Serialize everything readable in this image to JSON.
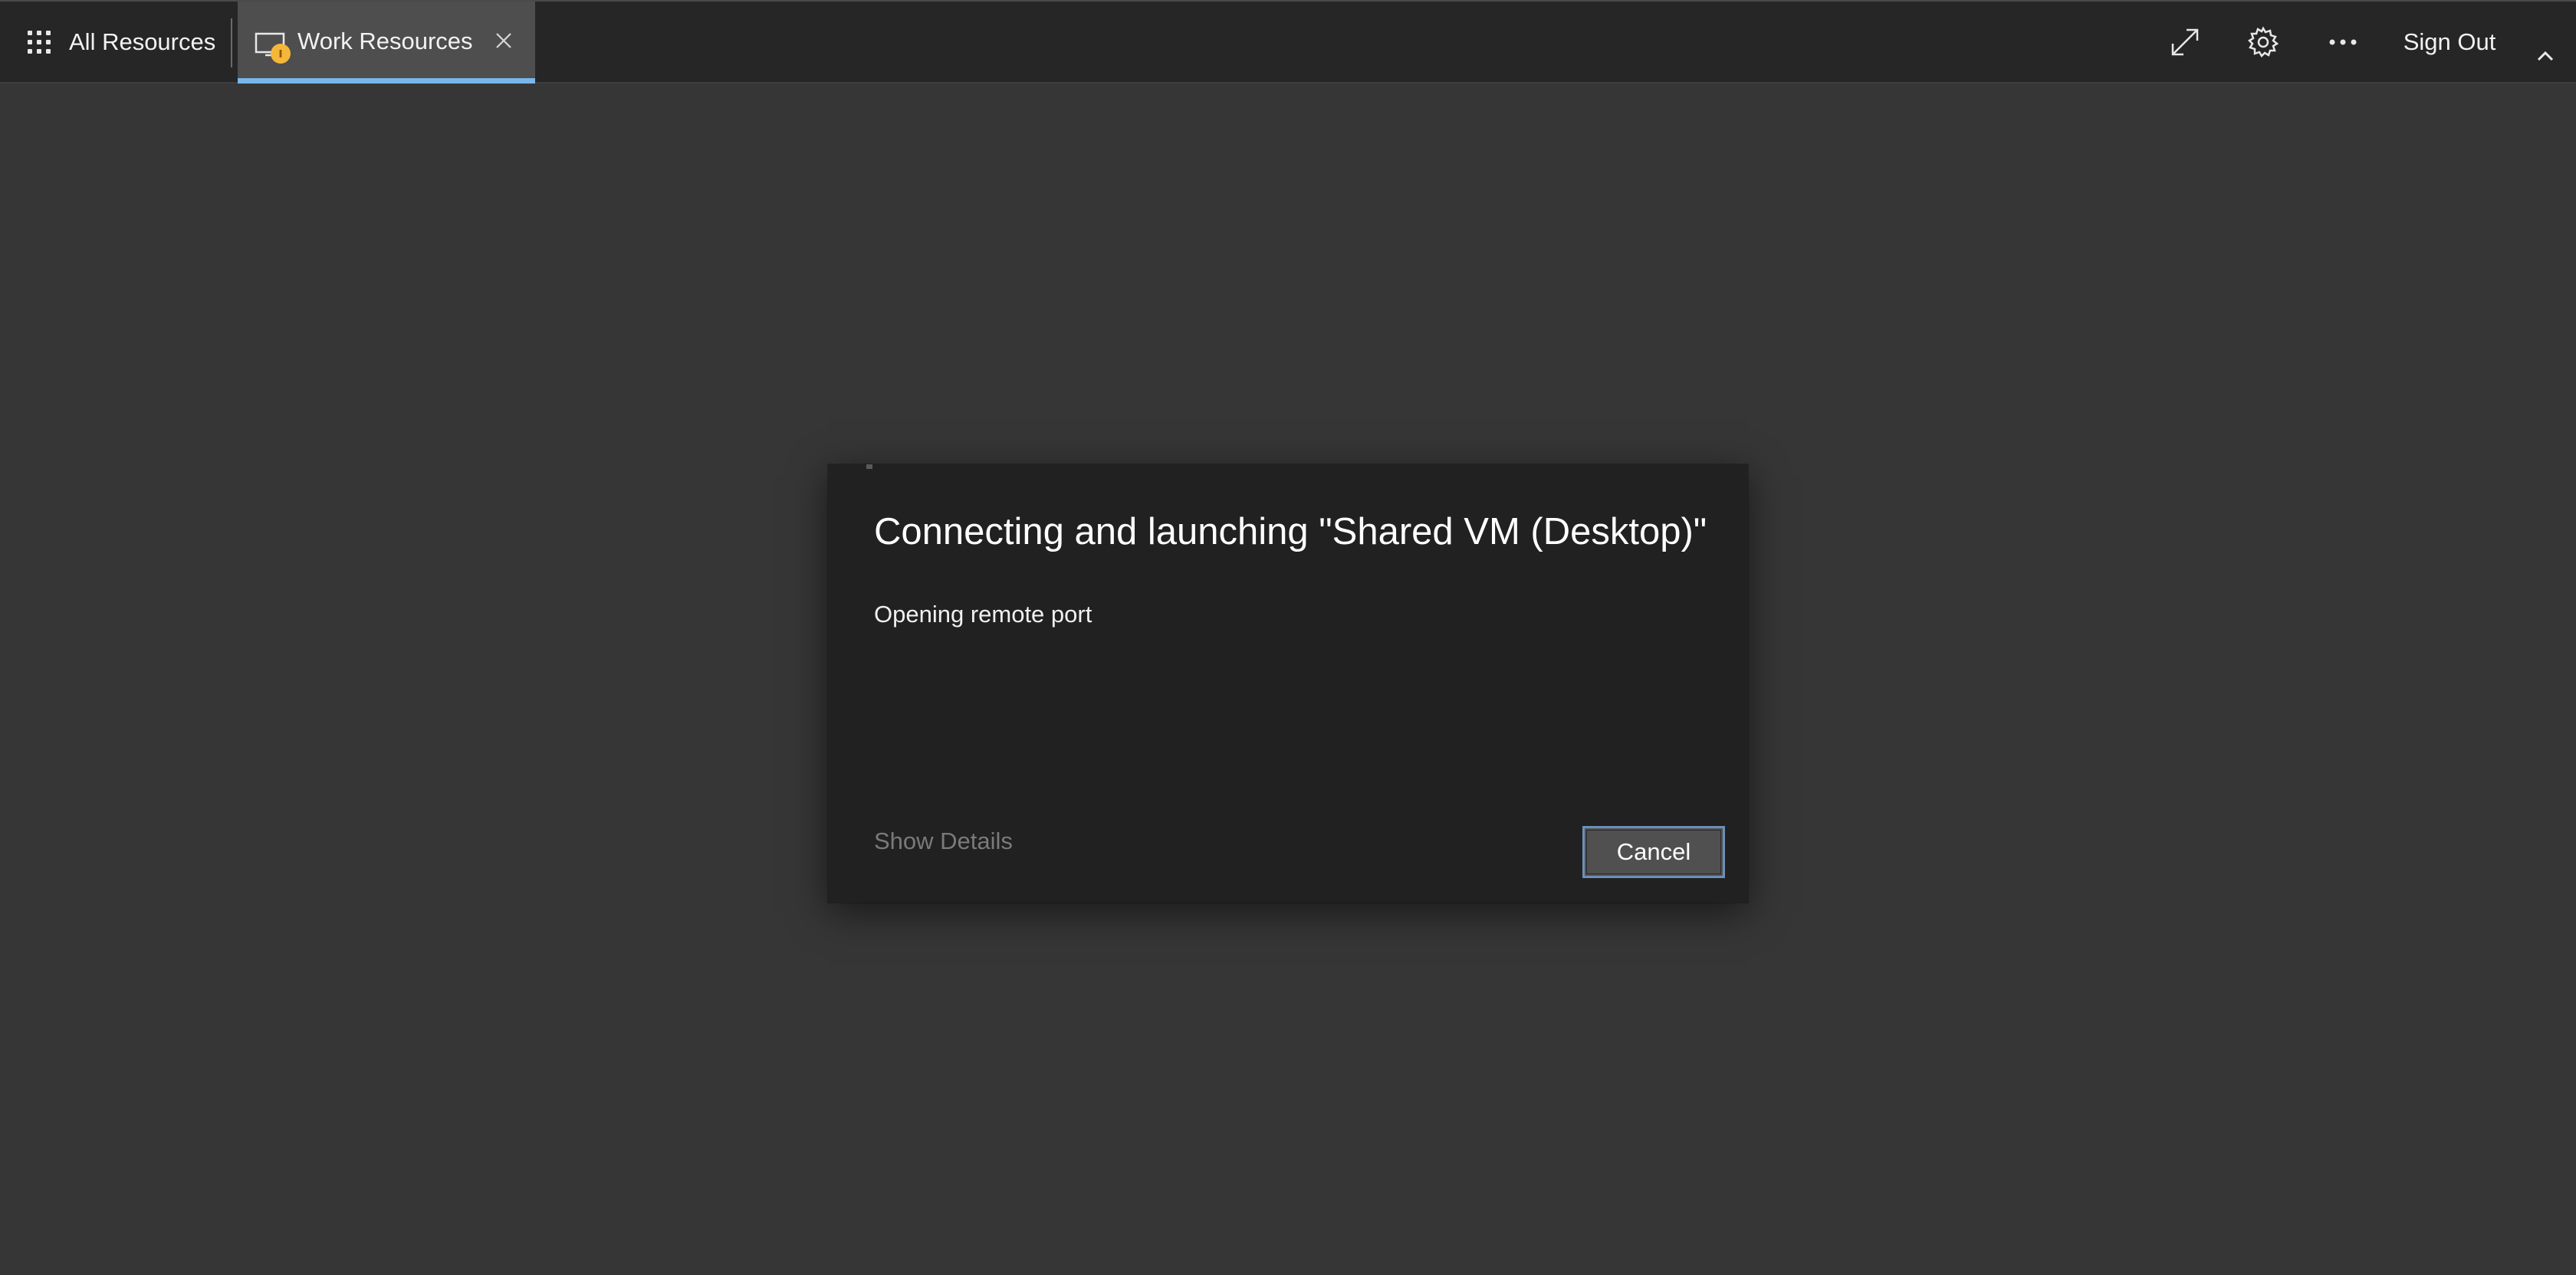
{
  "topbar": {
    "all_resources_label": "All Resources",
    "apps_icon": "app-grid-icon",
    "tab": {
      "label": "Work Resources",
      "icon": "remote-desktop-icon",
      "badge_icon": "info-badge-icon",
      "close_icon": "close-icon"
    },
    "tools": {
      "fullscreen_icon": "expand-icon",
      "settings_icon": "gear-icon",
      "more_icon": "ellipsis-icon",
      "sign_out_label": "Sign Out",
      "collapse_icon": "chevron-up-icon"
    }
  },
  "dialog": {
    "title": "Connecting and launching \"Shared VM (Desktop)\"",
    "status": "Opening remote port",
    "show_details_label": "Show Details",
    "cancel_label": "Cancel"
  },
  "colors": {
    "background": "#363636",
    "topbar": "#262626",
    "tab_active": "#4e4e4e",
    "tab_underline": "#7ab6ea",
    "dialog": "#212121",
    "badge": "#f4b73a",
    "cancel_border": "#6d8fb8"
  }
}
